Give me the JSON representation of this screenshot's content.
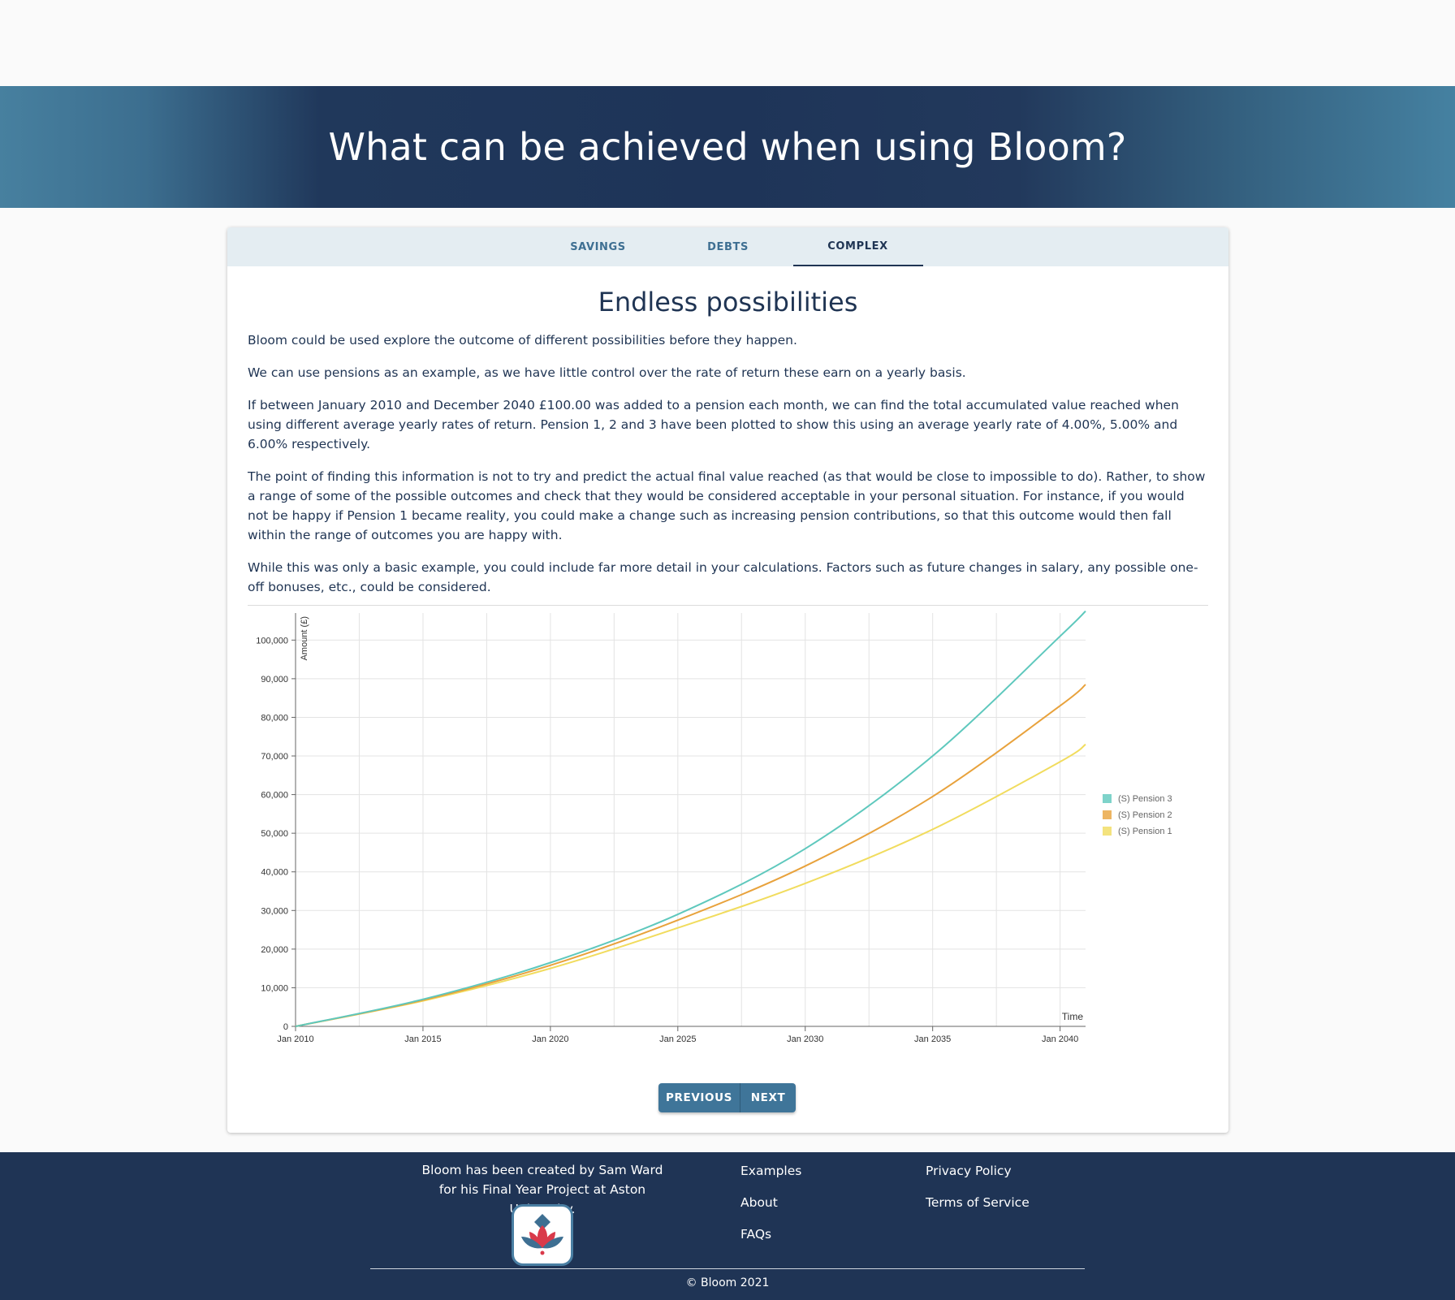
{
  "hero": {
    "title": "What can be achieved when using Bloom?"
  },
  "tabs": [
    {
      "label": "SAVINGS",
      "active": false
    },
    {
      "label": "DEBTS",
      "active": false
    },
    {
      "label": "COMPLEX",
      "active": true
    }
  ],
  "content": {
    "heading": "Endless possibilities",
    "paragraphs": [
      "Bloom could be used explore the outcome of different possibilities before they happen.",
      "We can use pensions as an example, as we have little control over the rate of return these earn on a yearly basis.",
      "If between January 2010 and December 2040 £100.00 was added to a pension each month, we can find the total accumulated value reached when using different average yearly rates of return. Pension 1, 2 and 3 have been plotted to show this using an average yearly rate of 4.00%, 5.00% and 6.00% respectively.",
      "The point of finding this information is not to try and predict the actual final value reached (as that would be close to impossible to do). Rather, to show a range of some of the possible outcomes and check that they would be considered acceptable in your personal situation. For instance, if you would not be happy if Pension 1 became reality, you could make a change such as increasing pension contributions, so that this outcome would then fall within the range of outcomes you are happy with.",
      "While this was only a basic example, you could include far more detail in your calculations. Factors such as future changes in salary, any possible one-off bonuses, etc., could be considered."
    ]
  },
  "chart_data": {
    "type": "line",
    "xlabel": "Time",
    "ylabel": "Amount (£)",
    "xlim": [
      2010,
      2041
    ],
    "ylim": [
      0,
      107000
    ],
    "x_ticks": [
      "Jan 2010",
      "Jan 2015",
      "Jan 2020",
      "Jan 2025",
      "Jan 2030",
      "Jan 2035",
      "Jan 2040"
    ],
    "y_ticks": [
      "0",
      "10,000",
      "20,000",
      "30,000",
      "40,000",
      "50,000",
      "60,000",
      "70,000",
      "80,000",
      "90,000",
      "100,000"
    ],
    "grid": true,
    "legend_position": "right",
    "x": [
      2010,
      2015,
      2020,
      2025,
      2030,
      2035,
      2040,
      2041
    ],
    "series": [
      {
        "name": "(S) Pension 3",
        "color": "#5ec8bd",
        "values": [
          0,
          7000,
          16500,
          29000,
          46000,
          70000,
          101000,
          107500
        ]
      },
      {
        "name": "(S) Pension 2",
        "color": "#e8a23c",
        "values": [
          0,
          6800,
          15800,
          27500,
          41500,
          59500,
          83000,
          88500
        ]
      },
      {
        "name": "(S) Pension 1",
        "color": "#f1dc5e",
        "values": [
          0,
          6600,
          15000,
          25500,
          37000,
          51000,
          68500,
          73000
        ]
      }
    ]
  },
  "nav_buttons": {
    "previous": "PREVIOUS",
    "next": "NEXT"
  },
  "footer": {
    "about": "Bloom has been created by Sam Ward for his Final Year Project at Aston University.",
    "links_col1": [
      "Examples",
      "About",
      "FAQs"
    ],
    "links_col2": [
      "Privacy Policy",
      "Terms of Service"
    ],
    "copyright": "© Bloom 2021"
  }
}
